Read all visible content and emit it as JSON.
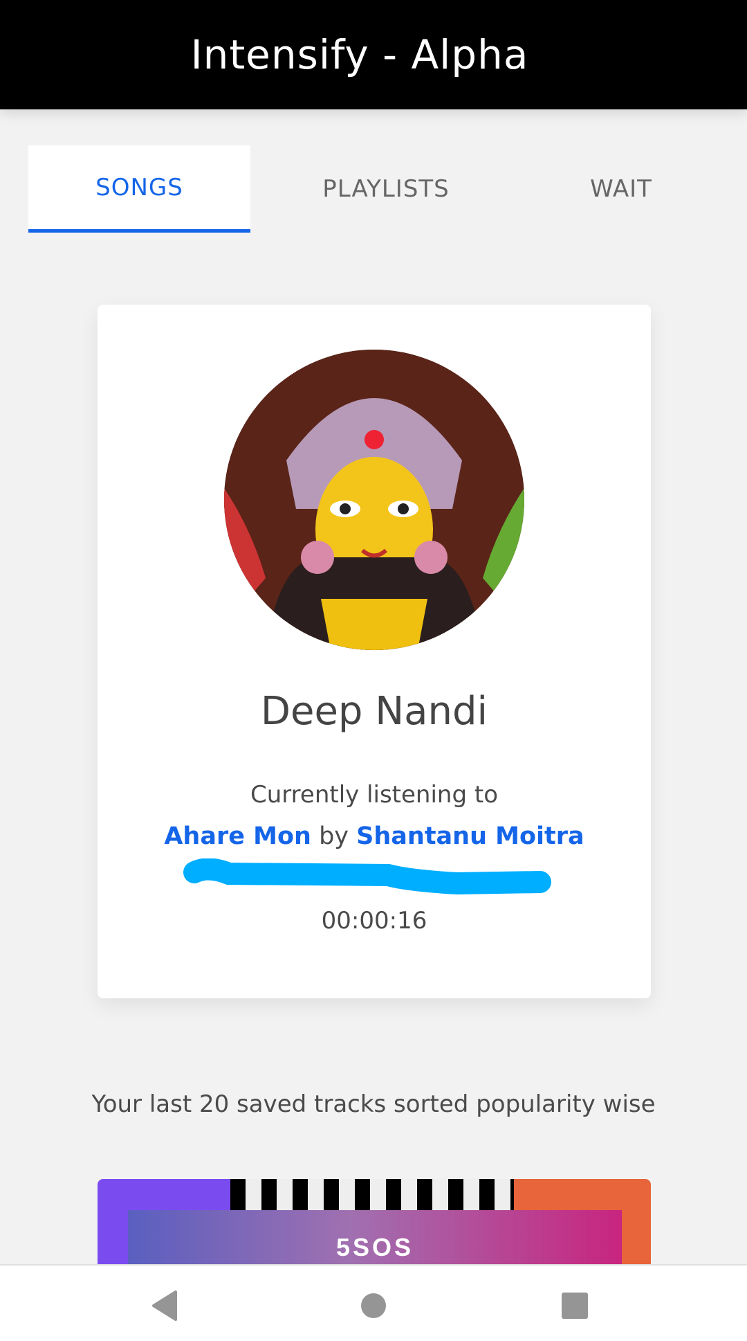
{
  "app": {
    "title": "Intensify - Alpha"
  },
  "tabs": [
    {
      "label": "SONGS",
      "active": true
    },
    {
      "label": "PLAYLISTS",
      "active": false
    },
    {
      "label": "WAIT",
      "active": false
    }
  ],
  "profile": {
    "name": "Deep Nandi",
    "listening_label": "Currently listening to",
    "track": "Ahare Mon",
    "by": "by",
    "artist": "Shantanu Moitra",
    "elapsed": "00:00:16"
  },
  "saved": {
    "subtitle": "Your last 20 saved tracks sorted popularity wise",
    "first_album_text": "5SOS"
  },
  "colors": {
    "accent": "#1565e8",
    "header": "#000000",
    "redaction": "#00aeff"
  }
}
